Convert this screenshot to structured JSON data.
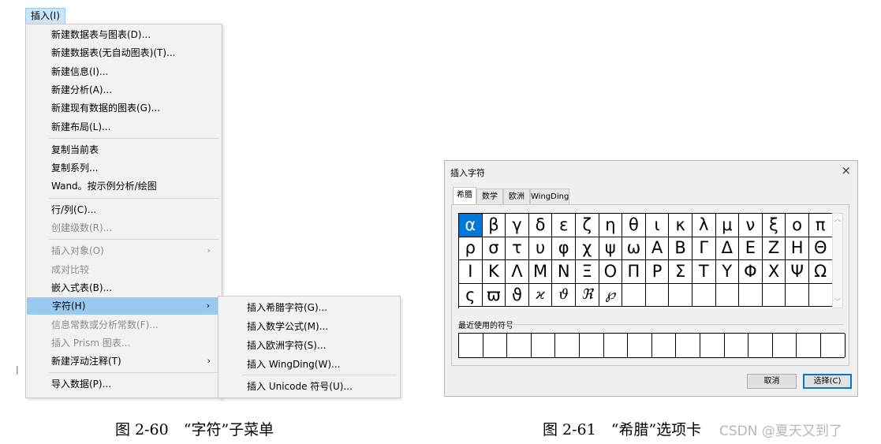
{
  "menubar": {
    "label": "插入(I)"
  },
  "menu": {
    "groups": [
      [
        {
          "label": "新建数据表与图表(D)...",
          "disabled": false
        },
        {
          "label": "新建数据表(无自动图表)(T)...",
          "disabled": false
        },
        {
          "label": "新建信息(I)...",
          "disabled": false
        },
        {
          "label": "新建分析(A)...",
          "disabled": false
        },
        {
          "label": "新建现有数据的图表(G)...",
          "disabled": false
        },
        {
          "label": "新建布局(L)...",
          "disabled": false
        }
      ],
      [
        {
          "label": "复制当前表",
          "disabled": false
        },
        {
          "label": "复制系列...",
          "disabled": false
        },
        {
          "label": "Wand。按示例分析/绘图",
          "disabled": false
        }
      ],
      [
        {
          "label": "行/列(C)...",
          "disabled": false
        },
        {
          "label": "创建级数(R)...",
          "disabled": true
        }
      ],
      [
        {
          "label": "插入对象(O)",
          "disabled": true,
          "submenu": true
        },
        {
          "label": "成对比较",
          "disabled": true
        },
        {
          "label": "嵌入式表(B)...",
          "disabled": false
        },
        {
          "label": "字符(H)",
          "disabled": false,
          "submenu": true,
          "highlighted": true
        },
        {
          "label": "信息常数或分析常数(F)...",
          "disabled": true
        },
        {
          "label": "插入 Prism 图表...",
          "disabled": true
        },
        {
          "label": "新建浮动注释(T)",
          "disabled": false,
          "submenu": true
        }
      ],
      [
        {
          "label": "导入数据(P)...",
          "disabled": false
        }
      ]
    ]
  },
  "submenu": {
    "items": [
      {
        "label": "插入希腊字符(G)..."
      },
      {
        "label": "插入数学公式(M)..."
      },
      {
        "label": "插入欧洲字符(S)..."
      },
      {
        "label": "插入 WingDing(W)..."
      },
      {
        "label": "插入 Unicode 符号(U)..."
      }
    ]
  },
  "dialog": {
    "title": "插入字符",
    "close": "×",
    "tabs": [
      "希腊",
      "数学",
      "欧洲",
      "WingDing"
    ],
    "active_tab": 0,
    "characters": [
      "α",
      "β",
      "γ",
      "δ",
      "ε",
      "ζ",
      "η",
      "θ",
      "ι",
      "κ",
      "λ",
      "μ",
      "ν",
      "ξ",
      "ο",
      "π",
      "ρ",
      "σ",
      "τ",
      "υ",
      "φ",
      "χ",
      "ψ",
      "ω",
      "Α",
      "Β",
      "Γ",
      "Δ",
      "Ε",
      "Ζ",
      "Η",
      "Θ",
      "Ι",
      "Κ",
      "Λ",
      "Μ",
      "Ν",
      "Ξ",
      "Ο",
      "Π",
      "Ρ",
      "Σ",
      "Τ",
      "Υ",
      "Φ",
      "Χ",
      "Ψ",
      "Ω",
      "ς",
      "ϖ",
      "ϑ",
      "ϰ",
      "ϑ",
      "ℜ",
      "℘",
      "",
      "",
      "",
      "",
      "",
      "",
      "",
      "",
      ""
    ],
    "selected_index": 0,
    "recent_label": "最近使用的符号",
    "recent_slots": 16,
    "buttons": {
      "cancel": "取消",
      "select": "选择(C)"
    }
  },
  "captions": {
    "left": "图 2-60　“字符”子菜单",
    "right": "图 2-61　“希腊”选项卡"
  },
  "watermark": "CSDN @夏天又到了"
}
